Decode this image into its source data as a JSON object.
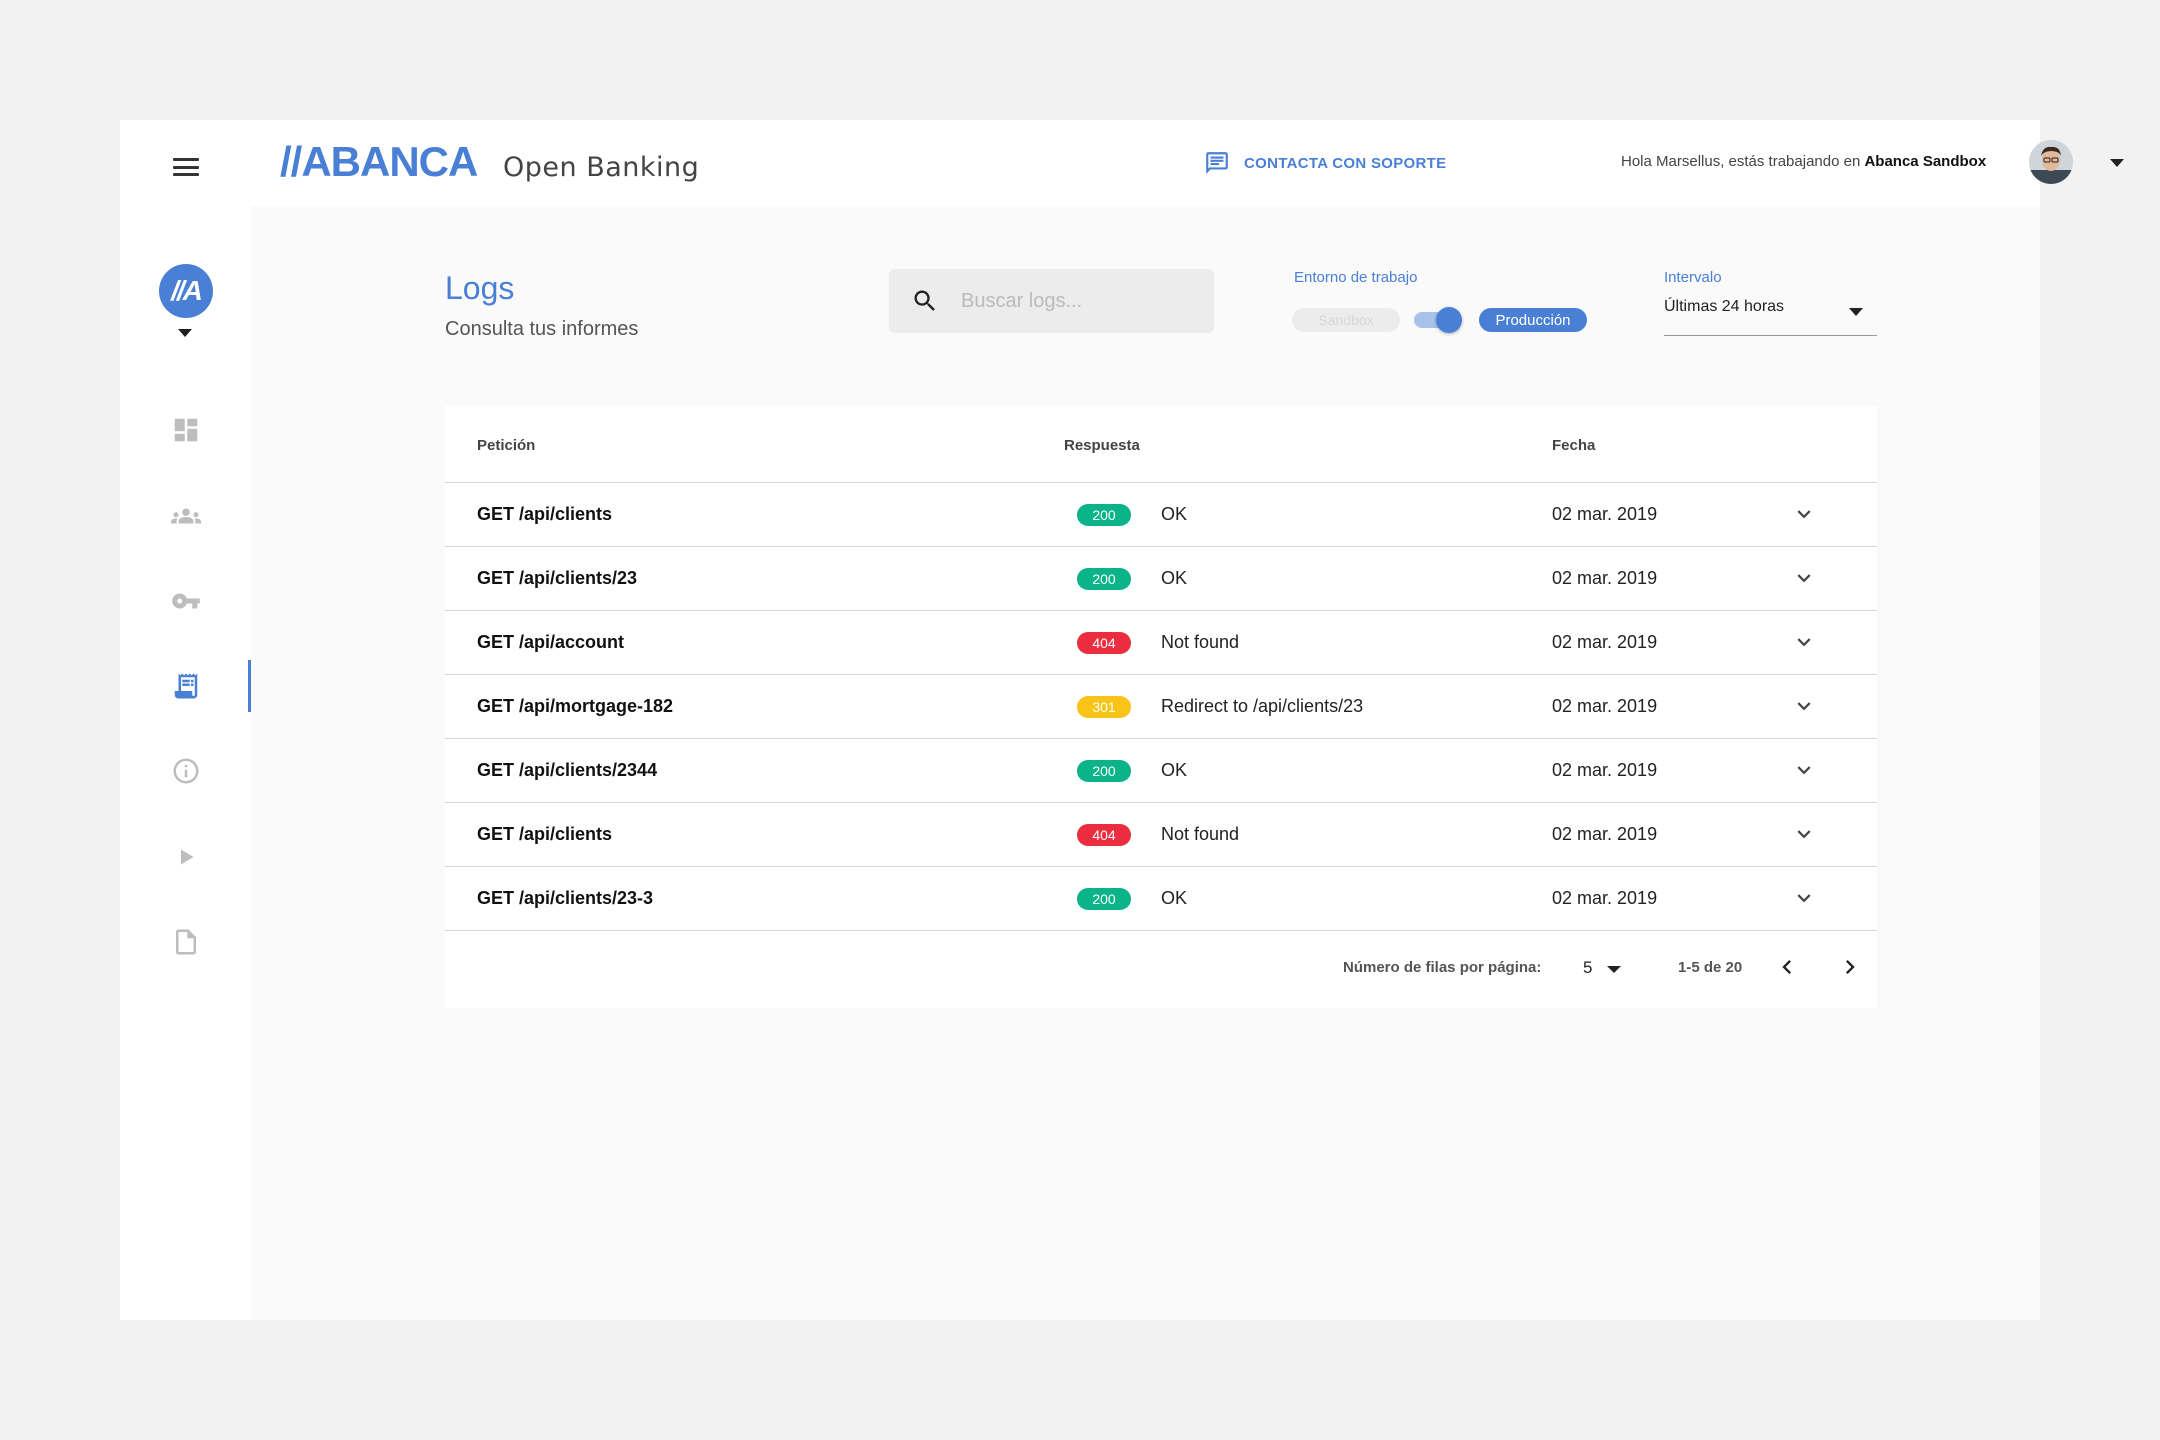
{
  "sidebar": {
    "org_initials": "//A",
    "items": [
      {
        "name": "dashboard"
      },
      {
        "name": "users"
      },
      {
        "name": "keys"
      },
      {
        "name": "logs",
        "active": true
      },
      {
        "name": "info"
      },
      {
        "name": "play"
      },
      {
        "name": "document"
      }
    ]
  },
  "header": {
    "logo": "//ABANCA",
    "product": "Open Banking",
    "support_label": "CONTACTA CON SOPORTE",
    "greeting_prefix": "Hola Marsellus, estás trabajando en",
    "workspace": "Abanca Sandbox"
  },
  "page": {
    "title": "Logs",
    "subtitle": "Consulta tus informes"
  },
  "search": {
    "placeholder": "Buscar logs..."
  },
  "environment": {
    "label": "Entorno de trabajo",
    "option_off": "Sandbox",
    "option_on": "Producción"
  },
  "interval": {
    "label": "Intervalo",
    "value": "Últimas 24 horas"
  },
  "table": {
    "columns": {
      "request": "Petición",
      "response": "Respuesta",
      "date": "Fecha"
    },
    "rows": [
      {
        "request": "GET /api/clients",
        "code": "200",
        "status": "OK",
        "date": "02 mar. 2019"
      },
      {
        "request": "GET /api/clients/23",
        "code": "200",
        "status": "OK",
        "date": "02 mar. 2019"
      },
      {
        "request": "GET /api/account",
        "code": "404",
        "status": "Not found",
        "date": "02 mar. 2019"
      },
      {
        "request": "GET /api/mortgage-182",
        "code": "301",
        "status": "Redirect to /api/clients/23",
        "date": "02 mar. 2019"
      },
      {
        "request": "GET /api/clients/2344",
        "code": "200",
        "status": "OK",
        "date": "02 mar. 2019"
      },
      {
        "request": "GET /api/clients",
        "code": "404",
        "status": "Not found",
        "date": "02 mar. 2019"
      },
      {
        "request": "GET /api/clients/23-3",
        "code": "200",
        "status": "OK",
        "date": "02 mar. 2019"
      }
    ]
  },
  "pagination": {
    "rows_label": "Número de filas por página:",
    "rows_value": "5",
    "range": "1-5 de 20"
  },
  "colors": {
    "accent": "#4a7fd6",
    "ok": "#0bb388",
    "error": "#ec2d3f",
    "redirect": "#f7c417"
  }
}
